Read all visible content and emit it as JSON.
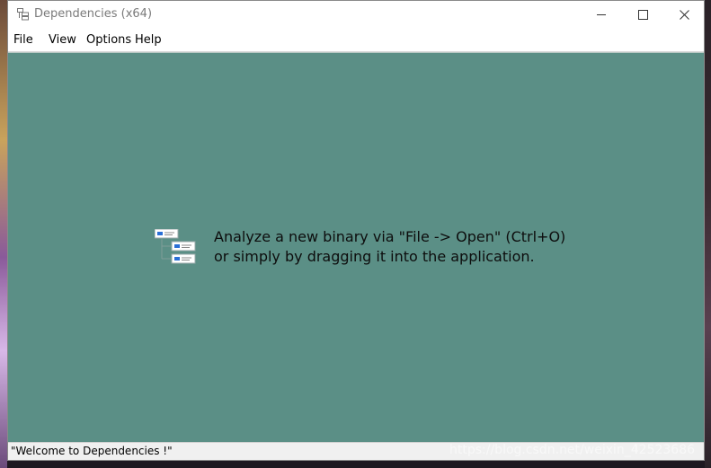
{
  "window": {
    "title": "Dependencies (x64)",
    "controls": {
      "minimize": "minimize",
      "maximize": "maximize",
      "close": "close"
    }
  },
  "menu": {
    "items": [
      {
        "label": "File"
      },
      {
        "label": "View"
      },
      {
        "label": "Options"
      },
      {
        "label": "Help"
      }
    ]
  },
  "main": {
    "welcome_line1": "Analyze a new binary via \"File -> Open\" (Ctrl+O)",
    "welcome_line2": "or simply by dragging it into the application.",
    "background_color": "#5b8f86"
  },
  "status": {
    "text": "\"Welcome to Dependencies !\""
  },
  "watermark": {
    "text": "https://blog.csdn.net/weixin_42523686"
  }
}
